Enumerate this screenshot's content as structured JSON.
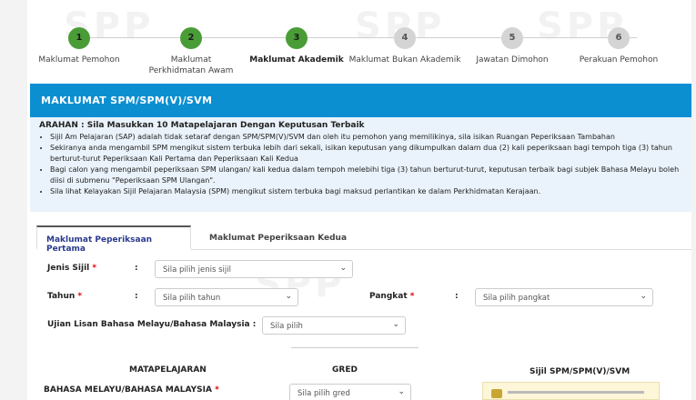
{
  "stepper": {
    "steps": [
      {
        "number": "1",
        "label": "Maklumat Pemohon",
        "status": "done"
      },
      {
        "number": "2",
        "label": "Maklumat Perkhidmatan Awam",
        "status": "done"
      },
      {
        "number": "3",
        "label": "Maklumat Akademik",
        "status": "current"
      },
      {
        "number": "4",
        "label": "Maklumat Bukan Akademik",
        "status": "todo"
      },
      {
        "number": "5",
        "label": "Jawatan Dimohon",
        "status": "todo"
      },
      {
        "number": "6",
        "label": "Perakuan Pemohon",
        "status": "todo"
      }
    ]
  },
  "section": {
    "title": "MAKLUMAT SPM/SPM(V)/SVM"
  },
  "arahan": {
    "title": "ARAHAN : Sila Masukkan 10 Matapelajaran Dengan Keputusan Terbaik",
    "items": [
      "Sijil Am Pelajaran (SAP) adalah tidak setaraf dengan SPM/SPM(V)/SVM dan oleh itu pemohon yang memilikinya, sila isikan Ruangan Peperiksaan Tambahan",
      "Sekiranya anda mengambil SPM mengikut sistem terbuka lebih dari sekali, isikan keputusan yang dikumpulkan dalam dua (2) kali peperiksaan bagi tempoh tiga (3) tahun berturut-turut Peperiksaan Kali Pertama dan Peperiksaan Kali Kedua",
      "Bagi calon yang mengambil peperiksaan SPM ulangan/ kali kedua dalam tempoh melebihi tiga (3) tahun berturut-turut, keputusan terbaik bagi subjek Bahasa Melayu boleh diisi di submenu \"Peperiksaan SPM Ulangan\".",
      "Sila lihat Kelayakan Sijil Pelajaran Malaysia (SPM) mengikut sistem terbuka bagi maksud perlantikan ke dalam Perkhidmatan Kerajaan."
    ]
  },
  "tabs": {
    "first": "Maklumat Peperiksaan Pertama",
    "second": "Maklumat Peperiksaan Kedua"
  },
  "form": {
    "jenis_sijil_label": "Jenis Sijil",
    "jenis_sijil_value": "Sila pilih jenis sijil",
    "tahun_label": "Tahun",
    "tahun_value": "Sila pilih tahun",
    "pangkat_label": "Pangkat",
    "pangkat_value": "Sila pilih pangkat",
    "ujian_label": "Ujian Lisan Bahasa Melayu/Bahasa Malaysia :",
    "ujian_value": "Sila pilih",
    "required_mark": "*",
    "colon": ":"
  },
  "subjects": {
    "col_matapelajaran": "MATAPELAJARAN",
    "col_gred": "GRED",
    "col_sijil": "Sijil SPM/SPM(V)/SVM",
    "row1_subject": "BAHASA MELAYU/BAHASA MALAYSIA",
    "row1_grade": "Sila pilih gred"
  },
  "watermark": "SPP",
  "colors": {
    "header_blue": "#0b8fd1",
    "done_green": "#4a9d36",
    "todo_grey": "#d4d4d4",
    "tab_active_text": "#2a3a8c",
    "required_red": "#dd0000"
  }
}
